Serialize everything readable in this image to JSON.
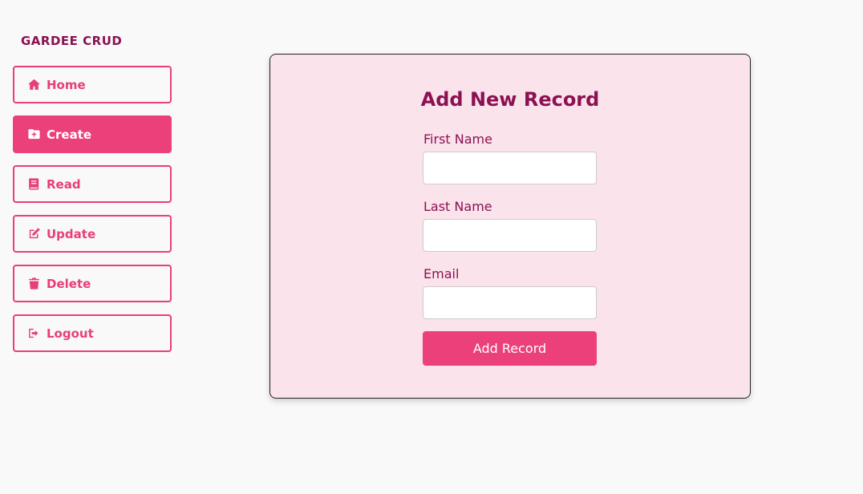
{
  "brand": "GARDEE CRUD",
  "nav": [
    {
      "label": "Home",
      "icon": "home-icon",
      "active": false
    },
    {
      "label": "Create",
      "icon": "folder-plus-icon",
      "active": true
    },
    {
      "label": "Read",
      "icon": "book-icon",
      "active": false
    },
    {
      "label": "Update",
      "icon": "edit-icon",
      "active": false
    },
    {
      "label": "Delete",
      "icon": "trash-icon",
      "active": false
    },
    {
      "label": "Logout",
      "icon": "logout-icon",
      "active": false
    }
  ],
  "form": {
    "title": "Add New Record",
    "first_name_label": "First Name",
    "first_name_value": "",
    "last_name_label": "Last Name",
    "last_name_value": "",
    "email_label": "Email",
    "email_value": "",
    "submit_label": "Add Record"
  },
  "colors": {
    "accent": "#ec407a",
    "text_dark": "#8b1152",
    "card_bg": "#fbe3eb",
    "page_bg": "#f9f9f9"
  }
}
